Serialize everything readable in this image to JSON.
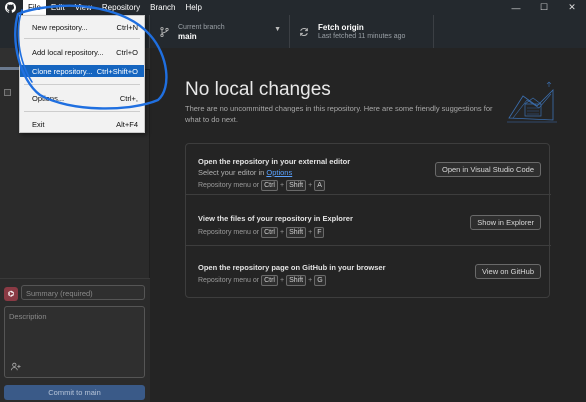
{
  "menubar": {
    "items": [
      "File",
      "Edit",
      "View",
      "Repository",
      "Branch",
      "Help"
    ],
    "active": "File"
  },
  "window_controls": {
    "minimize": "—",
    "maximize": "☐",
    "close": "✕"
  },
  "toolbar": {
    "branch_label": "Current branch",
    "branch_value": "main",
    "fetch_title": "Fetch origin",
    "fetch_sub": "Last fetched 11 minutes ago"
  },
  "file_menu": {
    "items": [
      {
        "label": "New repository...",
        "shortcut": "Ctrl+N"
      },
      {
        "label": "Add local repository...",
        "shortcut": "Ctrl+O"
      },
      {
        "label": "Clone repository...",
        "shortcut": "Ctrl+Shift+O"
      },
      {
        "label": "Options...",
        "shortcut": "Ctrl+,"
      },
      {
        "label": "Exit",
        "shortcut": "Alt+F4"
      }
    ],
    "highlighted": "Clone repository..."
  },
  "commit": {
    "summary_placeholder": "Summary (required)",
    "description_placeholder": "Description",
    "commit_button": "Commit to main"
  },
  "main": {
    "title": "No local changes",
    "subtitle": "There are no uncommitted changes in this repository. Here are some friendly suggestions for what to do next.",
    "suggestions": [
      {
        "title": "Open the repository in your external editor",
        "desc_prefix": "Select your editor in ",
        "desc_link": "Options",
        "hint_prefix": "Repository menu or",
        "keys": [
          "Ctrl",
          "Shift",
          "A"
        ],
        "button": "Open in Visual Studio Code"
      },
      {
        "title": "View the files of your repository in Explorer",
        "hint_prefix": "Repository menu or",
        "keys": [
          "Ctrl",
          "Shift",
          "F"
        ],
        "button": "Show in Explorer"
      },
      {
        "title": "Open the repository page on GitHub in your browser",
        "hint_prefix": "Repository menu or",
        "keys": [
          "Ctrl",
          "Shift",
          "G"
        ],
        "button": "View on GitHub"
      }
    ]
  },
  "colors": {
    "titlebar": "#24292e",
    "highlight": "#1565c0",
    "annotation": "#1f6fe0",
    "link": "#5aa2ff"
  }
}
